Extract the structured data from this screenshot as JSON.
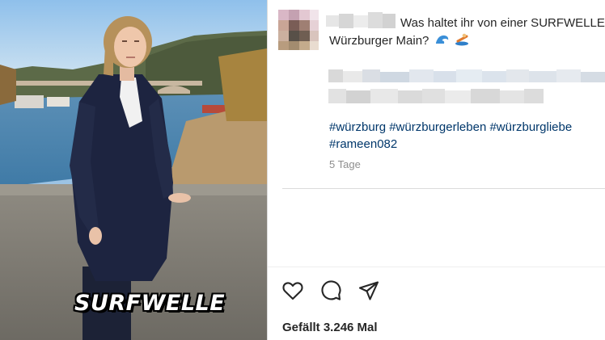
{
  "post": {
    "media": {
      "overlay_caption": "SURFWELLE"
    },
    "author": {
      "avatar_icon": "avatar-pixelated",
      "username_blurred": true
    },
    "caption": {
      "line1": "Was haltet ihr von einer SURFWELLE im",
      "line2": "Würzburger Main?",
      "emojis": [
        "wave-icon",
        "surfer-icon"
      ],
      "body_blurred": true
    },
    "hashtags": [
      "#würzburg",
      "#würzburgerleben",
      "#würzburgliebe",
      "#rameen082"
    ],
    "time_ago": "5 Tage",
    "actions": [
      "like-heart-icon",
      "comment-icon",
      "share-icon"
    ],
    "likes_text": "Gefällt 3.246 Mal"
  }
}
